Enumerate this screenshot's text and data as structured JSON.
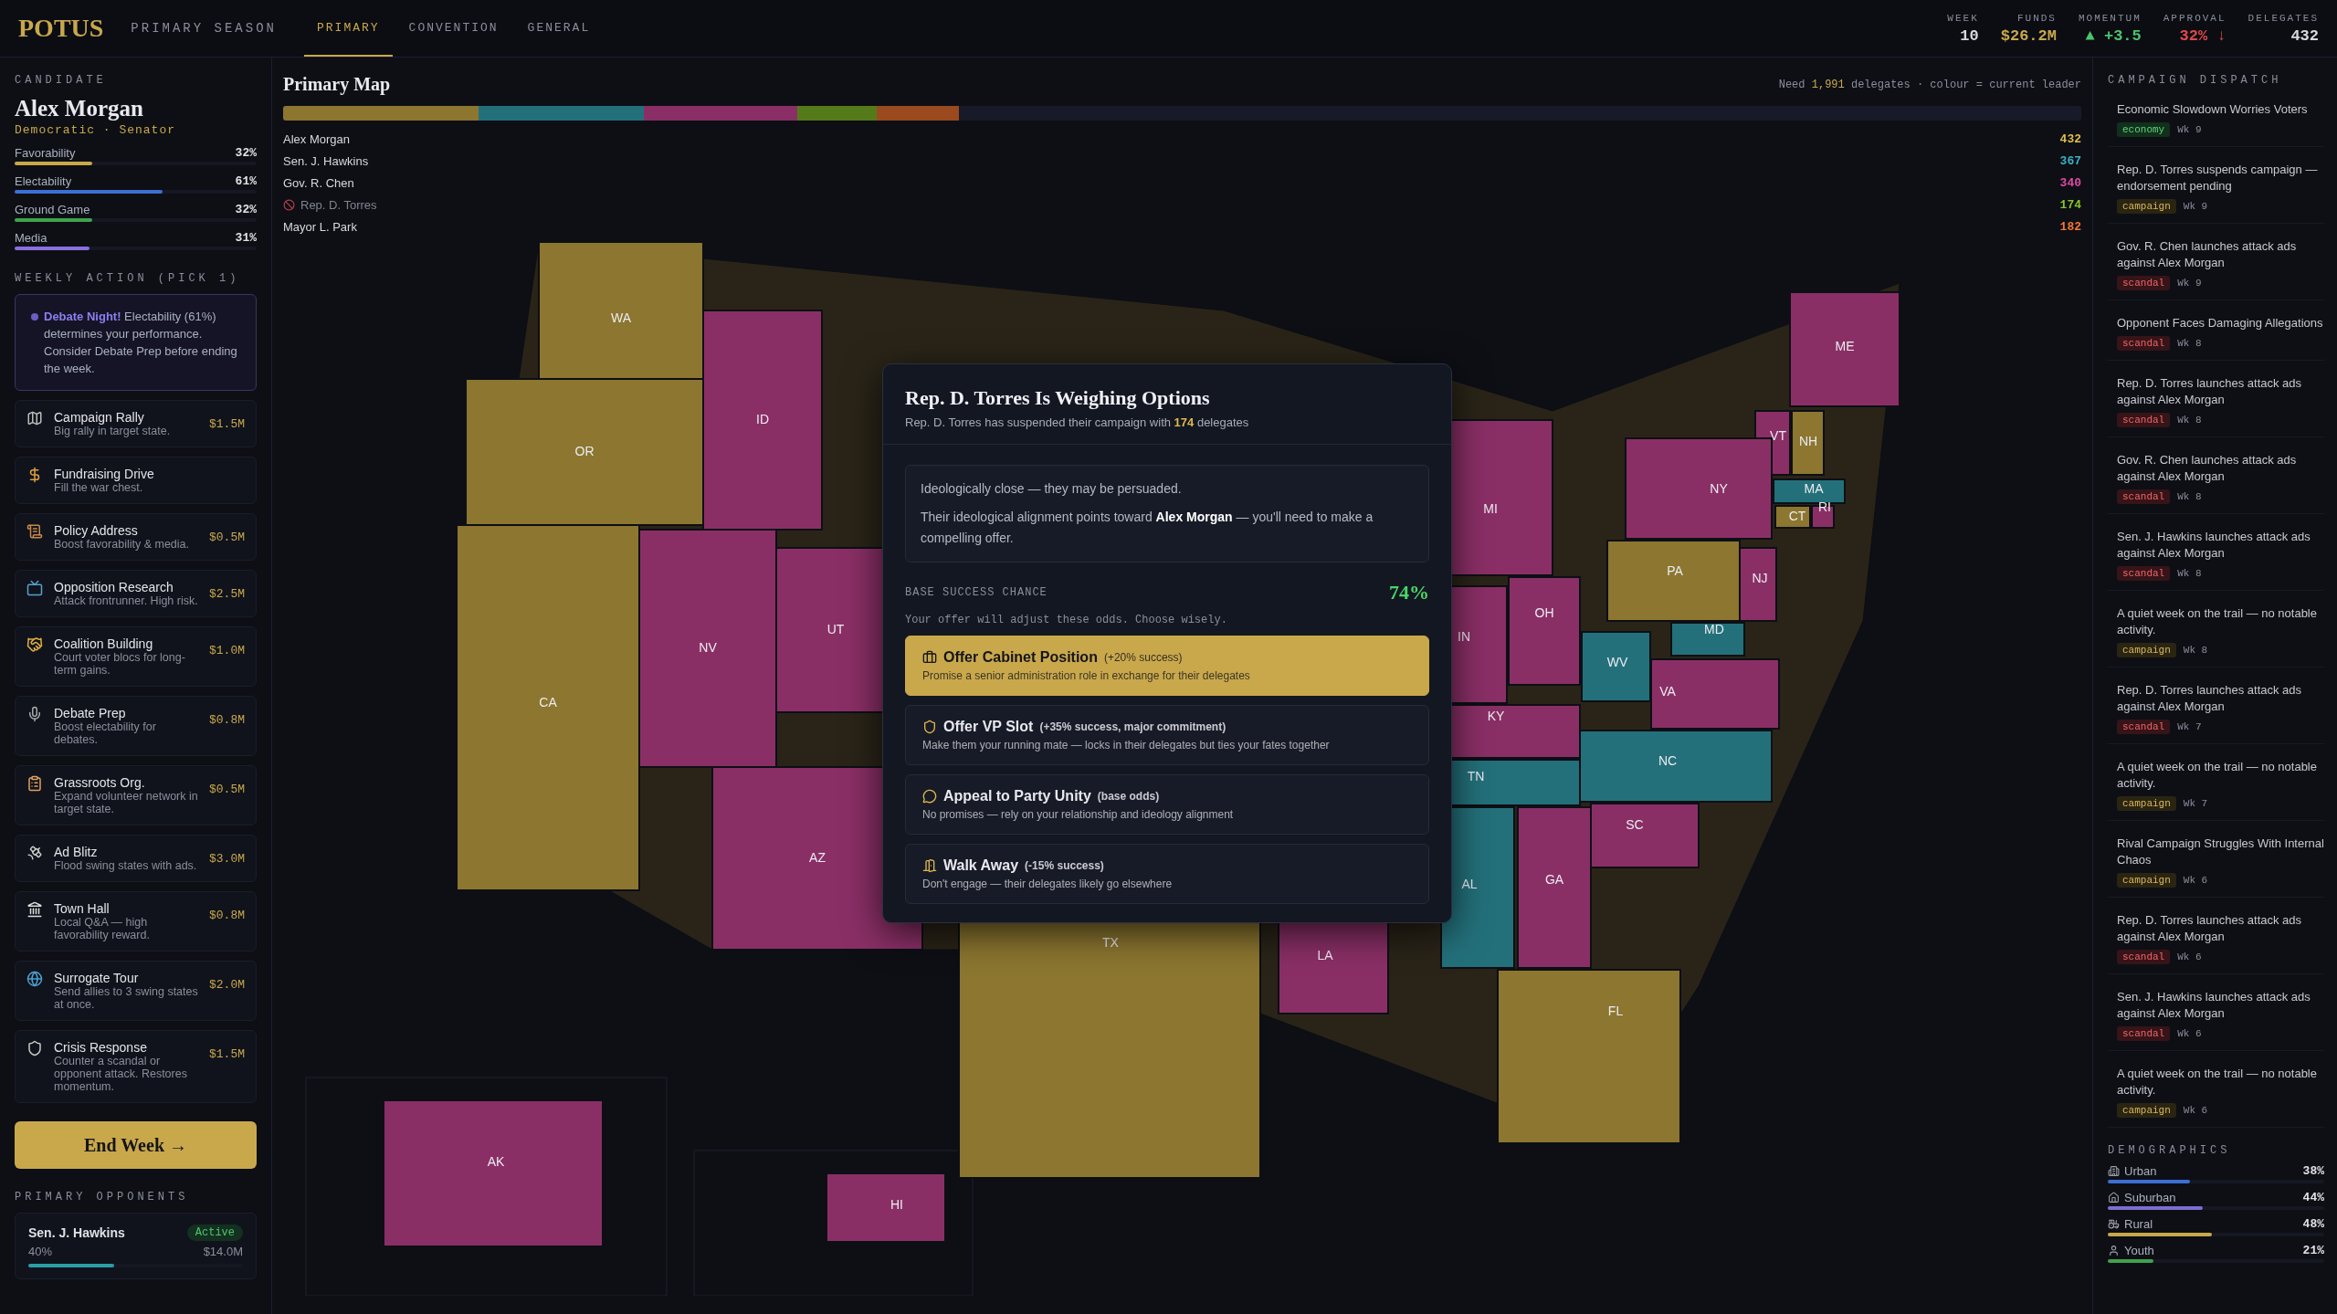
{
  "topbar": {
    "logo": "POTUS",
    "phase": "PRIMARY SEASON",
    "tabs": [
      {
        "label": "PRIMARY",
        "selected": true
      },
      {
        "label": "CONVENTION",
        "selected": false
      },
      {
        "label": "GENERAL",
        "selected": false
      }
    ],
    "stats": [
      {
        "label": "WEEK",
        "value": "10",
        "kind": "plain"
      },
      {
        "label": "FUNDS",
        "value": "$26.2M",
        "kind": "money"
      },
      {
        "label": "MOMENTUM",
        "value": "▲ +3.5",
        "kind": "up"
      },
      {
        "label": "APPROVAL",
        "value": "32% ↓",
        "kind": "down"
      },
      {
        "label": "DELEGATES",
        "value": "432",
        "kind": "plain"
      }
    ]
  },
  "candidate": {
    "section": "CANDIDATE",
    "name": "Alex Morgan",
    "party": "Democratic · Senator",
    "attributes": [
      {
        "label": "Favorability",
        "value": "32%",
        "level": 0.32,
        "color": "#c9a84c"
      },
      {
        "label": "Electability",
        "value": "61%",
        "level": 0.61,
        "color": "#3b6fd4"
      },
      {
        "label": "Ground Game",
        "value": "32%",
        "level": 0.32,
        "color": "#3fa34d"
      },
      {
        "label": "Media",
        "value": "31%",
        "level": 0.31,
        "color": "#8a6fe0"
      }
    ]
  },
  "weekly_action": {
    "section": "WEEKLY ACTION (PICK 1)",
    "alert": "**Debate Night!** Electability (61%) determines your performance. Consider Debate Prep before ending the week.",
    "actions": [
      {
        "name": "Campaign Rally",
        "desc": "Big rally in target state.",
        "cost": "$1.5M"
      },
      {
        "name": "Fundraising Drive",
        "desc": "Fill the war chest."
      },
      {
        "name": "Policy Address",
        "desc": "Boost favorability & media.",
        "cost": "$0.5M"
      },
      {
        "name": "Opposition Research",
        "desc": "Attack frontrunner. High risk.",
        "cost": "$2.5M"
      },
      {
        "name": "Coalition Building",
        "desc": "Court voter blocs for long-term gains.",
        "cost": "$1.0M"
      },
      {
        "name": "Debate Prep",
        "desc": "Boost electability for debates.",
        "cost": "$0.8M"
      },
      {
        "name": "Grassroots Org.",
        "desc": "Expand volunteer network in target state.",
        "cost": "$0.5M"
      },
      {
        "name": "Ad Blitz",
        "desc": "Flood swing states with ads.",
        "cost": "$3.0M"
      },
      {
        "name": "Town Hall",
        "desc": "Local Q&A — high favorability reward.",
        "cost": "$0.8M"
      },
      {
        "name": "Surrogate Tour",
        "desc": "Send allies to 3 swing states at once.",
        "cost": "$2.0M"
      },
      {
        "name": "Crisis Response",
        "desc": "Counter a scandal or opponent attack. Restores momentum.",
        "cost": "$1.5M"
      }
    ],
    "end_button": "End Week →"
  },
  "opponents": {
    "section": "PRIMARY OPPONENTS",
    "items": [
      {
        "name": "Sen. J. Hawkins",
        "status": "Active",
        "share": "40%",
        "funds": "$14.0M",
        "level": 0.4
      }
    ]
  },
  "map": {
    "title": "Primary Map",
    "note": "Need **1,991** delegates · colour = current leader",
    "candidates": [
      {
        "name": "Alex Morgan",
        "delegates": "432",
        "color": "#8c7630",
        "withdrawn": false
      },
      {
        "name": "Sen. J. Hawkins",
        "delegates": "367",
        "color": "#23707a",
        "withdrawn": false
      },
      {
        "name": "Gov. R. Chen",
        "delegates": "340",
        "color": "#8a2f66",
        "withdrawn": false
      },
      {
        "name": "Rep. D. Torres",
        "delegates": "174",
        "color": "#557a1a",
        "withdrawn": true
      },
      {
        "name": "Mayor L. Park",
        "delegates": "182",
        "color": "#9a4a1e",
        "withdrawn": false
      }
    ],
    "states": [
      {
        "label": "WA",
        "color": "#8c7630"
      },
      {
        "label": "OR",
        "color": "#8c7630"
      },
      {
        "label": "ID",
        "color": "#8a2f66"
      },
      {
        "label": "CA",
        "color": "#8c7630"
      },
      {
        "label": "NV",
        "color": "#8a2f66"
      },
      {
        "label": "UT",
        "color": "#8a2f66"
      },
      {
        "label": "AZ",
        "color": "#8a2f66"
      },
      {
        "label": "ME",
        "color": "#8a2f66"
      },
      {
        "label": "VT",
        "color": "#8a2f66"
      },
      {
        "label": "NH",
        "color": "#8c7630"
      },
      {
        "label": "NY",
        "color": "#8a2f66"
      },
      {
        "label": "MA",
        "color": "#23707a"
      },
      {
        "label": "CT",
        "color": "#8c7630"
      },
      {
        "label": "RI",
        "color": "#8a2f66"
      },
      {
        "label": "NJ",
        "color": "#8a2f66"
      },
      {
        "label": "PA",
        "color": "#8c7630"
      },
      {
        "label": "MD",
        "color": "#23707a"
      },
      {
        "label": "MI",
        "color": "#8a2f66"
      },
      {
        "label": "OH",
        "color": "#8a2f66"
      },
      {
        "label": "IN",
        "color": "#8a2f66"
      },
      {
        "label": "WV",
        "color": "#23707a"
      },
      {
        "label": "VA",
        "color": "#8a2f66"
      },
      {
        "label": "KY",
        "color": "#8a2f66"
      },
      {
        "label": "NC",
        "color": "#23707a"
      },
      {
        "label": "TN",
        "color": "#23707a"
      },
      {
        "label": "SC",
        "color": "#8a2f66"
      },
      {
        "label": "GA",
        "color": "#8a2f66"
      },
      {
        "label": "AL",
        "color": "#23707a"
      },
      {
        "label": "FL",
        "color": "#8c7630"
      },
      {
        "label": "LA",
        "color": "#8a2f66"
      },
      {
        "label": "TX",
        "color": "#8c7630"
      },
      {
        "label": "AK",
        "color": "#8a2f66"
      },
      {
        "label": "HI",
        "color": "#8a2f66"
      }
    ]
  },
  "dispatch": {
    "section": "CAMPAIGN DISPATCH",
    "items": [
      {
        "title": "Economic Slowdown Worries Voters",
        "tag": "economy",
        "week": "Wk 9"
      },
      {
        "title": "Rep. D. Torres suspends campaign — endorsement pending",
        "tag": "campaign",
        "week": "Wk 9"
      },
      {
        "title": "Gov. R. Chen launches attack ads against Alex Morgan",
        "tag": "scandal",
        "week": "Wk 9"
      },
      {
        "title": "Opponent Faces Damaging Allegations",
        "tag": "scandal",
        "week": "Wk 8"
      },
      {
        "title": "Rep. D. Torres launches attack ads against Alex Morgan",
        "tag": "scandal",
        "week": "Wk 8"
      },
      {
        "title": "Gov. R. Chen launches attack ads against Alex Morgan",
        "tag": "scandal",
        "week": "Wk 8"
      },
      {
        "title": "Sen. J. Hawkins launches attack ads against Alex Morgan",
        "tag": "scandal",
        "week": "Wk 8"
      },
      {
        "title": "A quiet week on the trail — no notable activity.",
        "tag": "campaign",
        "week": "Wk 8"
      },
      {
        "title": "Rep. D. Torres launches attack ads against Alex Morgan",
        "tag": "scandal",
        "week": "Wk 7"
      },
      {
        "title": "A quiet week on the trail — no notable activity.",
        "tag": "campaign",
        "week": "Wk 7"
      },
      {
        "title": "Rival Campaign Struggles With Internal Chaos",
        "tag": "campaign",
        "week": "Wk 6"
      },
      {
        "title": "Rep. D. Torres launches attack ads against Alex Morgan",
        "tag": "scandal",
        "week": "Wk 6"
      },
      {
        "title": "Sen. J. Hawkins launches attack ads against Alex Morgan",
        "tag": "scandal",
        "week": "Wk 6"
      },
      {
        "title": "A quiet week on the trail — no notable activity.",
        "tag": "campaign",
        "week": "Wk 6"
      }
    ]
  },
  "demographics": {
    "section": "DEMOGRAPHICS",
    "items": [
      {
        "label": "Urban",
        "value": "38%",
        "level": 0.38,
        "color": "#3b6fd4"
      },
      {
        "label": "Suburban",
        "value": "44%",
        "level": 0.44,
        "color": "#7a6fd0"
      },
      {
        "label": "Rural",
        "value": "48%",
        "level": 0.48,
        "color": "#c9a84c"
      },
      {
        "label": "Youth",
        "value": "21%",
        "level": 0.21,
        "color": "#3fa34d"
      }
    ]
  },
  "modal": {
    "title": "Rep. D. Torres Is Weighing Options",
    "subtitle": "Rep. D. Torres has suspended their campaign with **174** delegates",
    "info": [
      "Ideologically close — they may be persuaded.",
      "Their ideological alignment points toward **Alex Morgan** — you'll need to make a compelling offer."
    ],
    "chance_label": "BASE SUCCESS CHANCE",
    "chance": "74%",
    "hint": "Your offer will adjust these odds. Choose wisely.",
    "options": [
      {
        "title": "Offer Cabinet Position",
        "effect": "(+20% success)",
        "desc": "Promise a senior administration role in exchange for their delegates",
        "selected": true
      },
      {
        "title": "Offer VP Slot",
        "effect": "(+35% success, major commitment)",
        "desc": "Make them your running mate — locks in their delegates but ties your fates together",
        "selected": false
      },
      {
        "title": "Appeal to Party Unity",
        "effect": "(base odds)",
        "desc": "No promises — rely on your relationship and ideology alignment",
        "selected": false
      },
      {
        "title": "Walk Away",
        "effect": "(-15% success)",
        "desc": "Don't engage — their delegates likely go elsewhere",
        "selected": false
      }
    ]
  }
}
